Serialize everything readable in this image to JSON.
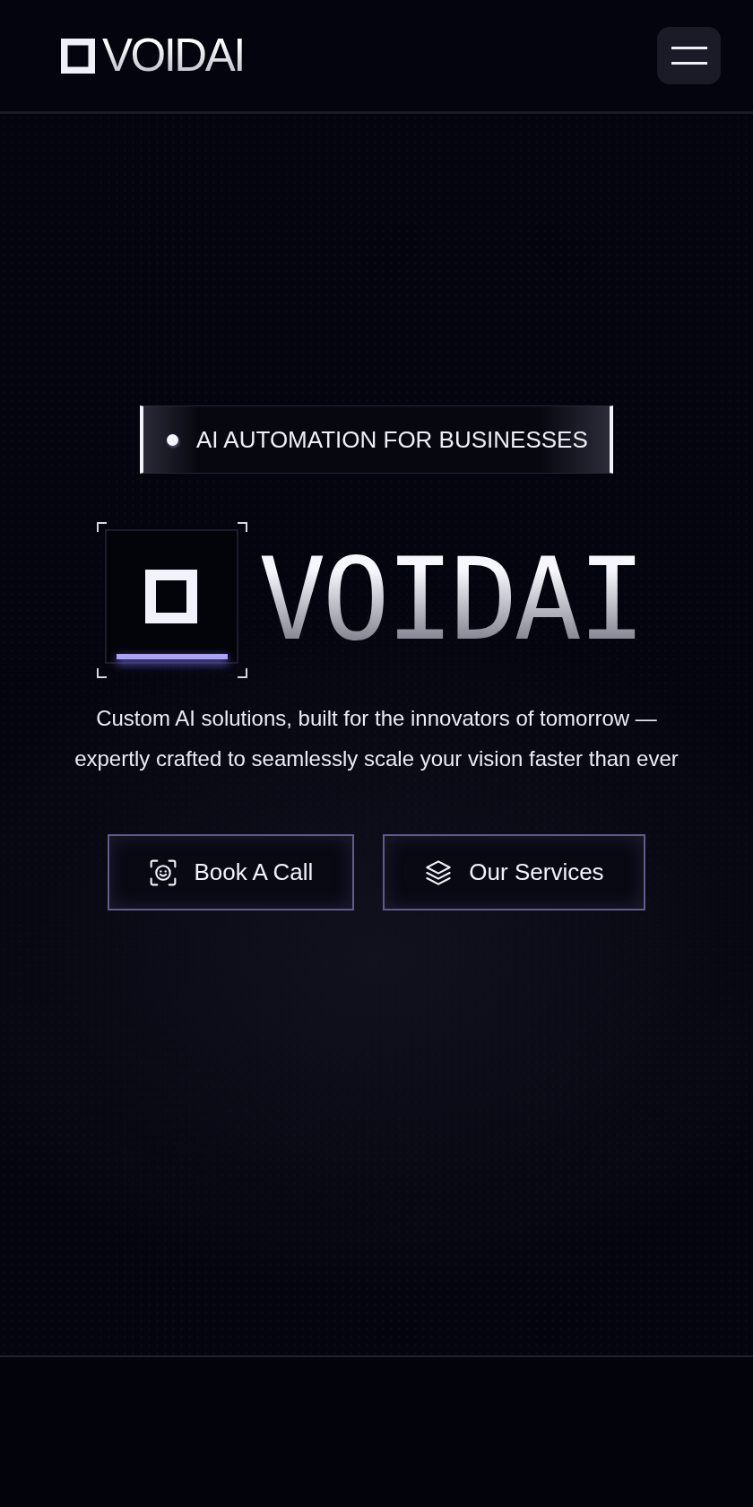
{
  "header": {
    "logo": "VOIDAI"
  },
  "hero": {
    "badge": "AI AUTOMATION FOR BUSINESSES",
    "title": "VOIDAI",
    "description": "Custom AI solutions, built for the innovators of tomorrow — expertly crafted to seamlessly scale your vision faster than ever",
    "buttons": [
      {
        "label": "Book A Call"
      },
      {
        "label": "Our Services"
      }
    ]
  }
}
